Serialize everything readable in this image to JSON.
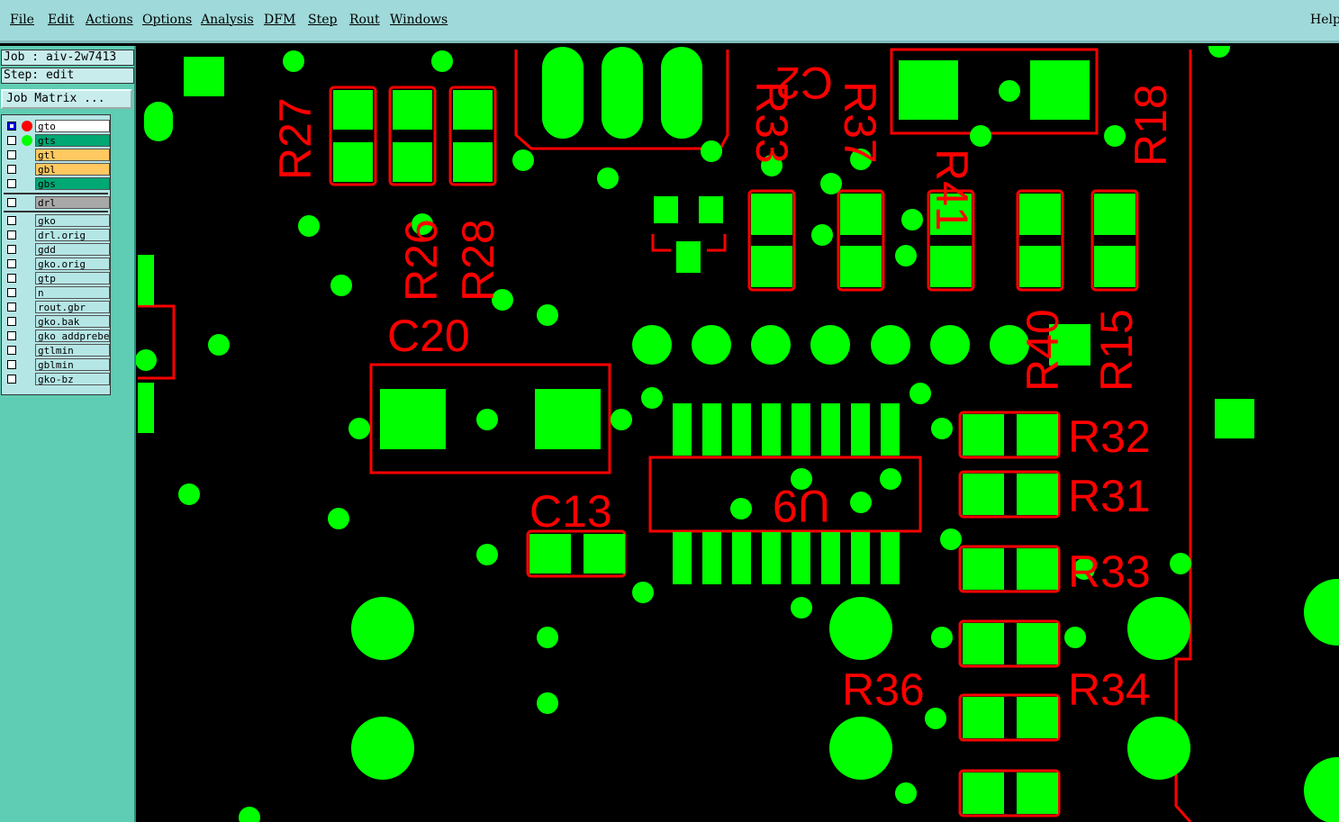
{
  "menubar": {
    "items": [
      "File",
      "Edit",
      "Actions",
      "Options",
      "Analysis",
      "DFM",
      "Step",
      "Rout",
      "Windows"
    ],
    "help": "Help"
  },
  "job": {
    "label": "Job : aiv-2w7413",
    "step": "Step: edit"
  },
  "job_matrix_button": "Job Matrix ...",
  "layers": [
    {
      "name": "gto",
      "bg": "#ffffff",
      "dot": "#ff0000",
      "active": true
    },
    {
      "name": "gts",
      "bg": "#00a874",
      "dot": "#00ff00",
      "active": false
    },
    {
      "name": "gtl",
      "bg": "#ffc860",
      "dot": "",
      "active": false
    },
    {
      "name": "gbl",
      "bg": "#ffc860",
      "dot": "",
      "active": false
    },
    {
      "name": "gbs",
      "bg": "#00a874",
      "dot": "",
      "active": false
    },
    {
      "name": "drl",
      "bg": "#a8a8a8",
      "dot": "",
      "active": false
    },
    {
      "name": "gko",
      "bg": "#b5e6e6",
      "dot": "",
      "active": false
    },
    {
      "name": "drl.orig",
      "bg": "#b5e6e6",
      "dot": "",
      "active": false
    },
    {
      "name": "gdd",
      "bg": "#b5e6e6",
      "dot": "",
      "active": false
    },
    {
      "name": "gko.orig",
      "bg": "#b5e6e6",
      "dot": "",
      "active": false
    },
    {
      "name": "gtp",
      "bg": "#b5e6e6",
      "dot": "",
      "active": false
    },
    {
      "name": "n",
      "bg": "#b5e6e6",
      "dot": "",
      "active": false
    },
    {
      "name": "rout.gbr",
      "bg": "#b5e6e6",
      "dot": "",
      "active": false
    },
    {
      "name": "gko.bak",
      "bg": "#b5e6e6",
      "dot": "",
      "active": false
    },
    {
      "name": "gko_addprebe",
      "bg": "#b5e6e6",
      "dot": "",
      "active": false
    },
    {
      "name": "gtlmin",
      "bg": "#b5e6e6",
      "dot": "",
      "active": false
    },
    {
      "name": "gblmin",
      "bg": "#b5e6e6",
      "dot": "",
      "active": false
    },
    {
      "name": "gko-bz",
      "bg": "#b5e6e6",
      "dot": "",
      "active": false
    }
  ],
  "pcb": {
    "silk_color": "#ff0000",
    "pad_color": "#00ff00",
    "labels": [
      "R27",
      "R26",
      "R28",
      "C20",
      "C13",
      "R33",
      "R37",
      "C2",
      "R41",
      "R18",
      "R40",
      "R15",
      "R32",
      "R31",
      "R33",
      "R36",
      "R34",
      "U9"
    ]
  }
}
